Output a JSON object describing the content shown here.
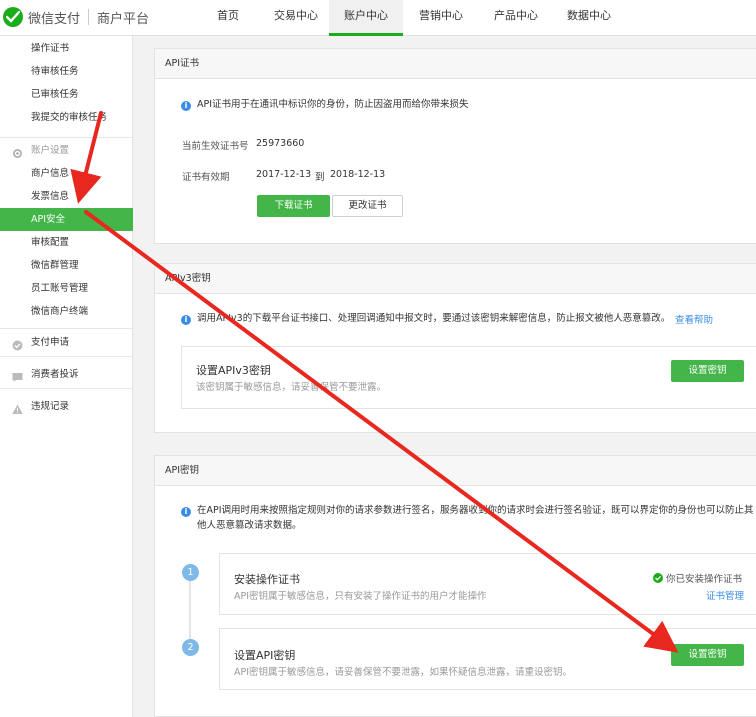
{
  "header": {
    "brand": "微信支付",
    "sub": "商户平台",
    "nav": [
      {
        "label": "首页"
      },
      {
        "label": "交易中心"
      },
      {
        "label": "账户中心"
      },
      {
        "label": "营销中心"
      },
      {
        "label": "产品中心"
      },
      {
        "label": "数据中心"
      }
    ]
  },
  "sidebar": {
    "top_items": [
      "操作证书",
      "待审核任务",
      "已审核任务",
      "我提交的审核任务"
    ],
    "account_group": "账户设置",
    "account_items": [
      "商户信息",
      "发票信息",
      "API安全",
      "审核配置",
      "微信群管理",
      "员工账号管理",
      "微信商户终端"
    ],
    "pay_group": "支付申请",
    "complaint_group": "消费者投诉",
    "violation_group": "违规记录"
  },
  "cert": {
    "title": "API证书",
    "info": "API证书用于在通讯中标识你的身份，防止因盗用而给你带来损失",
    "serial_label": "当前生效证书号",
    "serial_value": "25973660",
    "valid_label": "证书有效期",
    "valid_from": "2017-12-13",
    "valid_to_word": "到",
    "valid_to": "2018-12-13",
    "download_btn": "下载证书",
    "change_btn": "更改证书"
  },
  "apiv3": {
    "title": "APIv3密钥",
    "info": "调用APIv3的下载平台证书接口、处理回调通知中报文时，要通过该密钥来解密信息，防止报文被他人恶意篡改。",
    "help_link": "查看帮助",
    "box_title": "设置APIv3密钥",
    "box_desc": "该密钥属于敏感信息，请妥善保管不要泄露。",
    "set_btn": "设置密钥"
  },
  "apikey": {
    "title": "API密钥",
    "info_line1": "在API调用时用来按照指定规则对你的请求参数进行签名，服务器收到你的请求时会进行签名验证，既可以界定你的身份也可以防止其",
    "info_line2": "他人恶意篡改请求数据。",
    "step1_num": "1",
    "step1_title": "安装操作证书",
    "step1_desc": "API密钥属于敏感信息，只有安装了操作证书的用户才能操作",
    "step1_status": "你已安装操作证书",
    "step1_link": "证书管理",
    "step2_num": "2",
    "step2_title": "设置API密钥",
    "step2_desc": "API密钥属于敏感信息，请妥善保管不要泄露，如果怀疑信息泄露，请重设密钥。",
    "set_btn": "设置密钥"
  },
  "colors": {
    "brand_green": "#1aad19",
    "button_green": "#44b549",
    "info_blue": "#3a8ee6",
    "annotation_red": "#e8281e"
  }
}
